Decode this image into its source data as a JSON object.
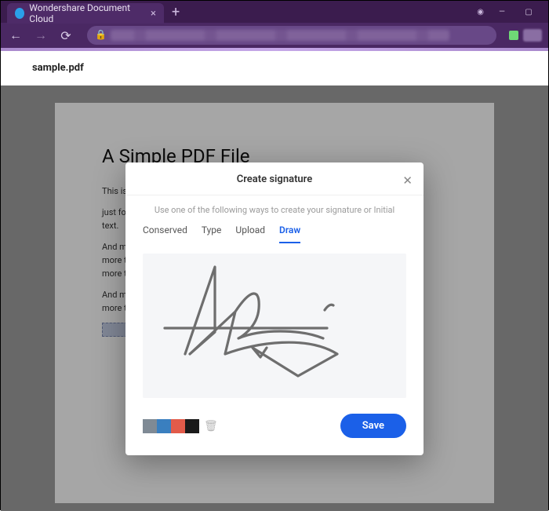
{
  "browser": {
    "tab_title": "Wondershare Document Cloud",
    "tab_close": "×",
    "tab_add": "+"
  },
  "document": {
    "filename": "sample.pdf"
  },
  "pdf": {
    "title": "A Simple PDF File",
    "p1": "This is a small demonstration .pdf file -",
    "p2": "just for use in the Virtual Mechanics tutorials. More text. And more text.",
    "p3": "And more text. And more text. And more text. And more text. And more text. And more more text. And more text. And more text. And more text.",
    "p4": "And more text. And more text. And more text. And more text. And more text."
  },
  "modal": {
    "title": "Create signature",
    "subtitle": "Use one of the following ways to create your signature or Initial",
    "tabs": {
      "conserved": "Conserved",
      "type": "Type",
      "upload": "Upload",
      "draw": "Draw"
    },
    "save": "Save",
    "swatches": [
      "#7f8a95",
      "#3a7fbf",
      "#e25b4a",
      "#1a1a1a"
    ]
  }
}
